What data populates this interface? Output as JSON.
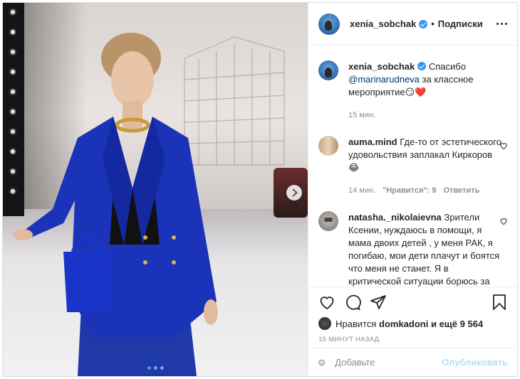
{
  "post": {
    "author": "xenia_sobchak",
    "header_separator": "•",
    "follow_label": "Подписки",
    "caption": {
      "user": "xenia_sobchak",
      "text_1": "Спасибо",
      "mention": "@marinarudneva",
      "text_2": "за классное мероприятие😏❤️",
      "time": "15 мин."
    },
    "photo": {
      "carousel_count": 3,
      "active_index": 0
    }
  },
  "comments": [
    {
      "user": "auma.mind",
      "text": "Где-то от эстетического удовольствия заплакал Киркоров 😂",
      "time": "14 мин.",
      "likes": "\"Нравится\": 9",
      "reply": "Ответить"
    },
    {
      "user": "natasha._nikolaievna",
      "text": "Зрители Ксении, нуждаюсь в помощи, я мама двоих детей , у меня РАК, я погибаю, мои дети плачут и боятся что меня не станет. Я в критической ситуации борюсь за жизнь. Лечение дорогое и для меня крайне неподъёмное. Рада"
    }
  ],
  "likes": {
    "prefix": "Нравится",
    "user": "domkadoni",
    "suffix": "и ещё 9 564"
  },
  "time_ago": "15 МИНУТ НАЗАД",
  "add_comment": {
    "placeholder": "Добавьте",
    "publish_label": "Опубликовать"
  },
  "colors": {
    "accent": "#3897f0",
    "publish_disabled": "#b2dffc",
    "mention": "#003569"
  }
}
